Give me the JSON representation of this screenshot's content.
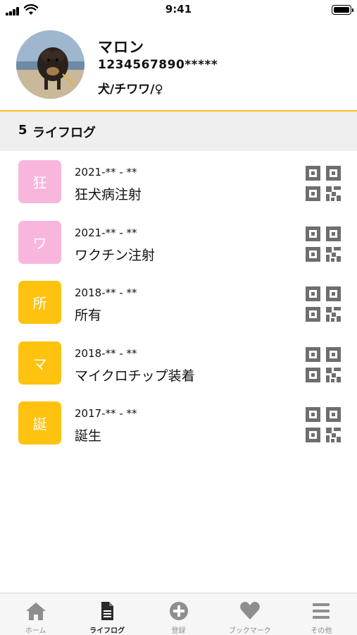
{
  "status_bar": {
    "time": "9:41"
  },
  "profile": {
    "name": "マロン",
    "id_number": "1234567890*****",
    "attributes": "犬/チワワ/♀"
  },
  "section": {
    "count": "5",
    "title": "ライフログ"
  },
  "log_items": [
    {
      "badge": "狂",
      "badge_color": "#f9b6dd",
      "date": "2021-** - **",
      "title": "狂犬病注射"
    },
    {
      "badge": "ワ",
      "badge_color": "#f9b6dd",
      "date": "2021-** - **",
      "title": "ワクチン注射"
    },
    {
      "badge": "所",
      "badge_color": "#ffc20e",
      "date": "2018-** - **",
      "title": "所有"
    },
    {
      "badge": "マ",
      "badge_color": "#ffc20e",
      "date": "2018-** - **",
      "title": "マイクロチップ装着"
    },
    {
      "badge": "誕",
      "badge_color": "#ffc20e",
      "date": "2017-** - **",
      "title": "誕生"
    }
  ],
  "tab_bar": {
    "tabs": [
      {
        "label": "ホーム",
        "icon": "home-icon"
      },
      {
        "label": "ライフログ",
        "icon": "document-icon",
        "active": true
      },
      {
        "label": "登録",
        "icon": "plus-circle-icon"
      },
      {
        "label": "ブックマーク",
        "icon": "heart-icon"
      },
      {
        "label": "その他",
        "icon": "menu-icon"
      }
    ]
  },
  "colors": {
    "accent": "#f7c21a",
    "badge_pink": "#f9b6dd",
    "badge_yellow": "#ffc20e",
    "icon_gray": "#6e6e6e"
  }
}
